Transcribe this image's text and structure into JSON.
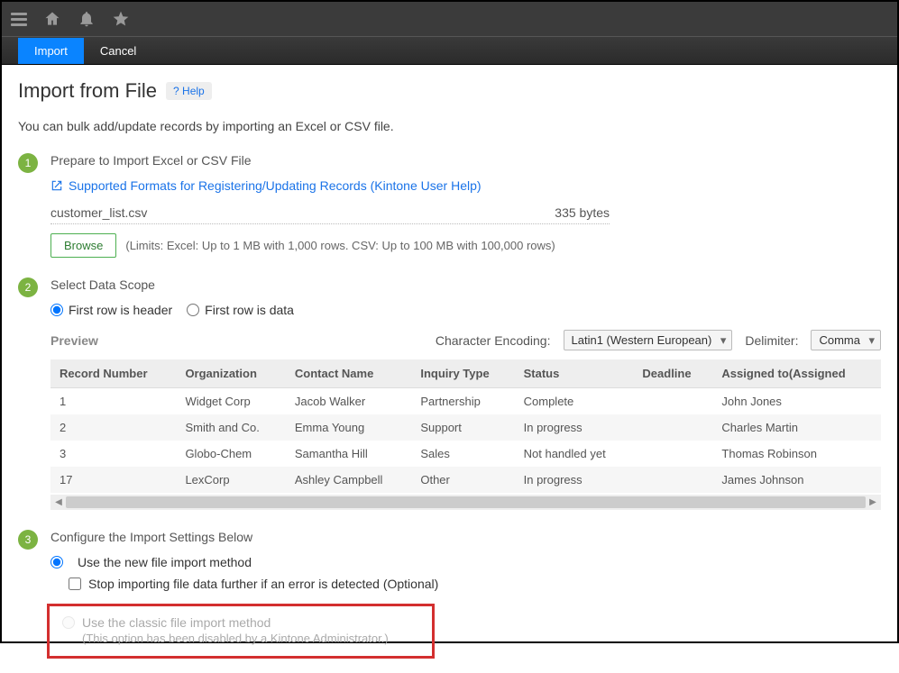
{
  "toolbar": {
    "import": "Import",
    "cancel": "Cancel"
  },
  "page": {
    "title": "Import from File",
    "help": "? Help",
    "description": "You can bulk add/update records by importing an Excel or CSV file."
  },
  "step1": {
    "num": "1",
    "title": "Prepare to Import Excel or CSV File",
    "help_link": "Supported Formats for Registering/Updating Records (Kintone User Help)",
    "filename": "customer_list.csv",
    "filesize": "335 bytes",
    "browse": "Browse",
    "limits": "(Limits: Excel: Up to 1 MB with 1,000 rows. CSV: Up to 100 MB with 100,000 rows)"
  },
  "step2": {
    "num": "2",
    "title": "Select Data Scope",
    "radio_header": "First row is header",
    "radio_data": "First row is data",
    "preview": "Preview",
    "encoding_label": "Character Encoding:",
    "encoding_value": "Latin1 (Western European)",
    "delimiter_label": "Delimiter:",
    "delimiter_value": "Comma",
    "headers": [
      "Record Number",
      "Organization",
      "Contact Name",
      "Inquiry Type",
      "Status",
      "Deadline",
      "Assigned to(Assigned"
    ],
    "rows": [
      [
        "1",
        "Widget Corp",
        "Jacob Walker",
        "Partnership",
        "Complete",
        "",
        "John Jones"
      ],
      [
        "2",
        "Smith and Co.",
        "Emma Young",
        "Support",
        "In progress",
        "",
        "Charles Martin"
      ],
      [
        "3",
        "Globo-Chem",
        "Samantha Hill",
        "Sales",
        "Not handled yet",
        "",
        "Thomas Robinson"
      ],
      [
        "17",
        "LexCorp",
        "Ashley Campbell",
        "Other",
        "In progress",
        "",
        "James Johnson"
      ]
    ]
  },
  "step3": {
    "num": "3",
    "title": "Configure the Import Settings Below",
    "radio_new": "Use the new file import method",
    "checkbox_stop": "Stop importing file data further if an error is detected (Optional)",
    "radio_classic": "Use the classic file import method",
    "classic_note": "(This option has been disabled by a Kintone Administrator.)"
  }
}
